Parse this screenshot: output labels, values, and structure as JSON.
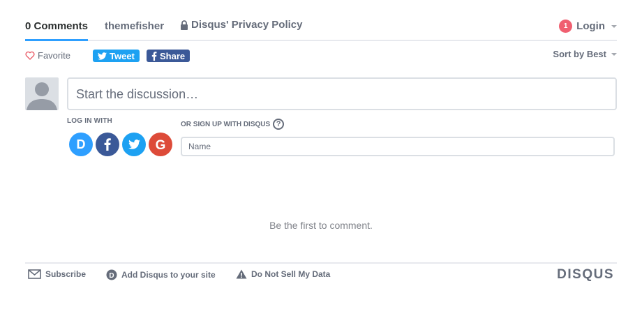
{
  "nav": {
    "comments_tab": "0 Comments",
    "site_tab": "themefisher",
    "privacy_tab": "Disqus' Privacy Policy",
    "login_badge": "1",
    "login_label": "Login"
  },
  "actions": {
    "favorite_label": "Favorite",
    "tweet_label": "Tweet",
    "share_label": "Share",
    "sort_label": "Sort by Best"
  },
  "composer": {
    "placeholder": "Start the discussion…",
    "login_with_label": "LOG IN WITH",
    "signup_label": "OR SIGN UP WITH DISQUS",
    "help_icon_text": "?",
    "name_placeholder": "Name",
    "social_icons": [
      "disqus-icon",
      "facebook-icon",
      "twitter-icon",
      "google-icon"
    ]
  },
  "empty_state": {
    "message": "Be the first to comment."
  },
  "footer": {
    "subscribe_label": "Subscribe",
    "add_disqus_label": "Add Disqus to your site",
    "do_not_sell_label": "Do Not Sell My Data",
    "logo_text": "DISQUS"
  },
  "colors": {
    "accent": "#2e9fff",
    "twitter": "#1da1f2",
    "facebook": "#3b5998",
    "google": "#dd4b39",
    "badge": "#f05f70",
    "muted_text": "#656c7a"
  }
}
